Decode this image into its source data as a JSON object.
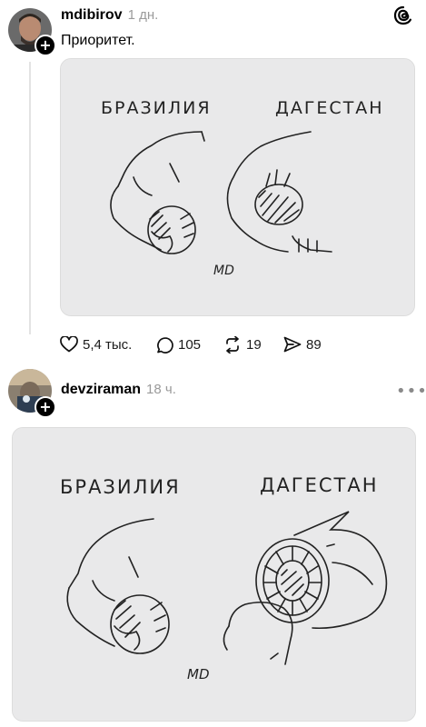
{
  "app": {
    "logo_icon": "threads-logo-icon"
  },
  "posts": [
    {
      "username": "mdibirov",
      "time": "1 дн.",
      "text": "Приоритет.",
      "image": {
        "label_left": "Бразилия",
        "label_right": "Дагестан",
        "signature": "MD"
      },
      "actions": {
        "likes": "5,4 тыс.",
        "replies": "105",
        "reposts": "19",
        "shares": "89"
      }
    },
    {
      "username": "devziraman",
      "time": "18 ч.",
      "more": "•••",
      "image": {
        "label_left": "Бразилия",
        "label_right": "Дагестан",
        "signature": "MD"
      }
    }
  ]
}
